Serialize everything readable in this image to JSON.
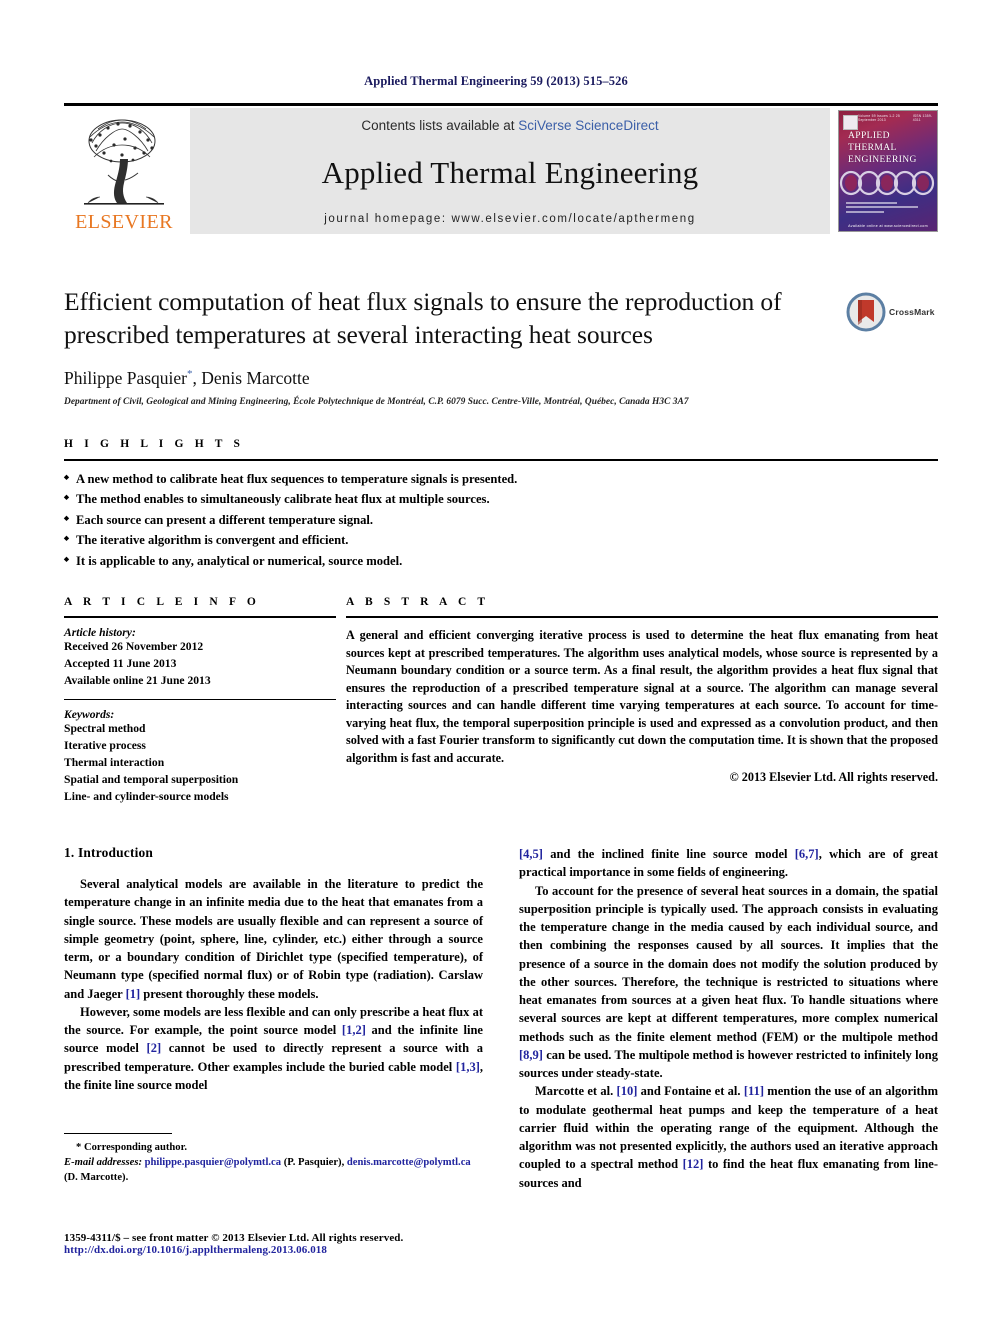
{
  "running_head": "Applied Thermal Engineering 59 (2013) 515–526",
  "masthead": {
    "publisher_name": "ELSEVIER",
    "contents_prefix": "Contents lists available at ",
    "contents_link": "SciVerse ScienceDirect",
    "journal_name": "Applied Thermal Engineering",
    "homepage_label": "journal homepage: www.elsevier.com/locate/apthermeng",
    "cover": {
      "title_lines": [
        "APPLIED",
        "THERMAL",
        "ENGINEERING"
      ],
      "top_left_meta": "Volume 59 Issues 1-2 25 September 2013",
      "top_right_meta": "ISSN 1359-4311",
      "footer_meta": "Available online at www.sciencedirect.com"
    }
  },
  "article": {
    "title": "Efficient computation of heat flux signals to ensure the reproduction of prescribed temperatures at several interacting heat sources",
    "authors": "Philippe Pasquier",
    "author_star": "*",
    "authors_rest": ", Denis Marcotte",
    "affiliation": "Department of Civil, Geological and Mining Engineering, École Polytechnique de Montréal, C.P. 6079 Succ. Centre-Ville, Montréal, Québec, Canada H3C 3A7",
    "crossmark_label": "CrossMark"
  },
  "highlights": {
    "heading": "H I G H L I G H T S",
    "items": [
      "A new method to calibrate heat flux sequences to temperature signals is presented.",
      "The method enables to simultaneously calibrate heat flux at multiple sources.",
      "Each source can present a different temperature signal.",
      "The iterative algorithm is convergent and efficient.",
      "It is applicable to any, analytical or numerical, source model."
    ]
  },
  "article_info": {
    "heading": "A R T I C L E  I N F O",
    "history_label": "Article history:",
    "history_lines": [
      "Received 26 November 2012",
      "Accepted 11 June 2013",
      "Available online 21 June 2013"
    ],
    "keywords_label": "Keywords:",
    "keywords": [
      "Spectral method",
      "Iterative process",
      "Thermal interaction",
      "Spatial and temporal superposition",
      "Line- and cylinder-source models"
    ]
  },
  "abstract": {
    "heading": "A B S T R A C T",
    "text": "A general and efficient converging iterative process is used to determine the heat flux emanating from heat sources kept at prescribed temperatures. The algorithm uses analytical models, whose source is represented by a Neumann boundary condition or a source term. As a final result, the algorithm provides a heat flux signal that ensures the reproduction of a prescribed temperature signal at a source. The algorithm can manage several interacting sources and can handle different time varying temperatures at each source. To account for time-varying heat flux, the temporal superposition principle is used and expressed as a convolution product, and then solved with a fast Fourier transform to significantly cut down the computation time. It is shown that the proposed algorithm is fast and accurate.",
    "copyright": "© 2013 Elsevier Ltd. All rights reserved."
  },
  "body": {
    "section_heading": "1.  Introduction",
    "left_paragraphs": [
      {
        "segments": [
          {
            "t": "Several analytical models are available in the literature to predict the temperature change in an infinite media due to the heat that emanates from a single source. These models are usually flexible and can represent a source of simple geometry (point, sphere, line, cylinder, etc.) either through a source term, or a boundary condition of Dirichlet type (specified temperature), of Neumann type (specified normal flux) or of Robin type (radiation). Carslaw and Jaeger "
          },
          {
            "t": "[1]",
            "ref": true
          },
          {
            "t": " present thoroughly these models."
          }
        ]
      },
      {
        "segments": [
          {
            "t": "However, some models are less flexible and can only prescribe a heat flux at the source. For example, the point source model "
          },
          {
            "t": "[1,2]",
            "ref": true
          },
          {
            "t": " and the infinite line source model "
          },
          {
            "t": "[2]",
            "ref": true
          },
          {
            "t": " cannot be used to directly represent a source with a prescribed temperature. Other examples include the buried cable model "
          },
          {
            "t": "[1,3]",
            "ref": true
          },
          {
            "t": ", the finite line source model"
          }
        ]
      }
    ],
    "right_paragraphs": [
      {
        "segments": [
          {
            "t": "[4,5]",
            "ref": true
          },
          {
            "t": " and the inclined finite line source model "
          },
          {
            "t": "[6,7]",
            "ref": true
          },
          {
            "t": ", which are of great practical importance in some fields of engineering."
          }
        ]
      },
      {
        "segments": [
          {
            "t": "To account for the presence of several heat sources in a domain, the spatial superposition principle is typically used. The approach consists in evaluating the temperature change in the media caused by each individual source, and then combining the responses caused by all sources. It implies that the presence of a source in the domain does not modify the solution produced by the other sources. Therefore, the technique is restricted to situations where heat emanates from sources at a given heat flux. To handle situations where several sources are kept at different temperatures, more complex numerical methods such as the finite element method (FEM) or the multipole method "
          },
          {
            "t": "[8,9]",
            "ref": true
          },
          {
            "t": " can be used. The multipole method is however restricted to infinitely long sources under steady-state."
          }
        ]
      },
      {
        "segments": [
          {
            "t": "Marcotte et al. "
          },
          {
            "t": "[10]",
            "ref": true
          },
          {
            "t": " and Fontaine et al. "
          },
          {
            "t": "[11]",
            "ref": true
          },
          {
            "t": " mention the use of an algorithm to modulate geothermal heat pumps and keep the temperature of a heat carrier fluid within the operating range of the equipment. Although the algorithm was not presented explicitly, the authors used an iterative approach coupled to a spectral method "
          },
          {
            "t": "[12]",
            "ref": true
          },
          {
            "t": " to find the heat flux emanating from line-sources and"
          }
        ]
      }
    ]
  },
  "footnote": {
    "corresponding": "* Corresponding author.",
    "email_label": "E-mail addresses:",
    "email1": "philippe.pasquier@polymtl.ca",
    "email1_who": " (P. Pasquier), ",
    "email2": "denis.marcotte@polymtl.ca",
    "email2_who": " (D. Marcotte)."
  },
  "bottom": {
    "issn_line": "1359-4311/$ – see front matter © 2013 Elsevier Ltd. All rights reserved.",
    "doi_line": "http://dx.doi.org/10.1016/j.applthermaleng.2013.06.018"
  },
  "colors": {
    "link_blue": "#21249e",
    "sciencedirect_blue": "#3b5fa8",
    "elsevier_orange": "#E87722",
    "band_gray": "#e6e6e6"
  }
}
